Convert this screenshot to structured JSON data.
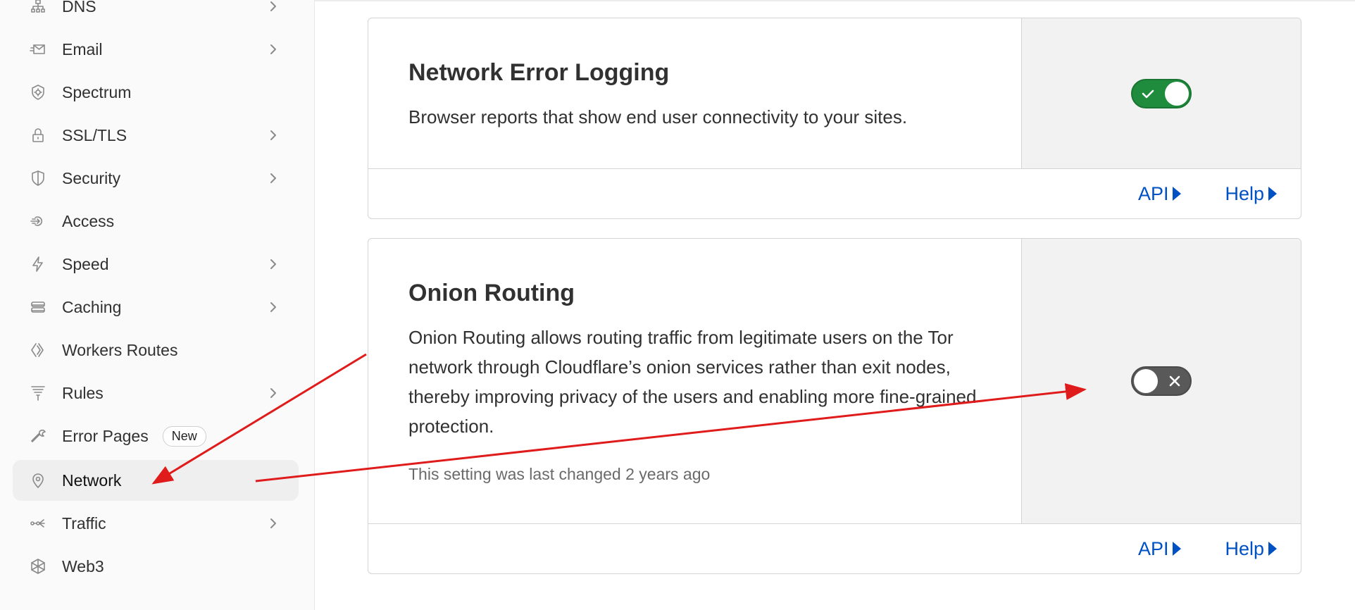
{
  "sidebar": {
    "items": [
      {
        "label": "DNS",
        "icon": "dns-icon",
        "chevron": true
      },
      {
        "label": "Email",
        "icon": "email-icon",
        "chevron": true
      },
      {
        "label": "Spectrum",
        "icon": "spectrum-icon",
        "chevron": false
      },
      {
        "label": "SSL/TLS",
        "icon": "lock-icon",
        "chevron": true
      },
      {
        "label": "Security",
        "icon": "shield-icon",
        "chevron": true
      },
      {
        "label": "Access",
        "icon": "access-icon",
        "chevron": false
      },
      {
        "label": "Speed",
        "icon": "lightning-icon",
        "chevron": true
      },
      {
        "label": "Caching",
        "icon": "server-icon",
        "chevron": true
      },
      {
        "label": "Workers Routes",
        "icon": "workers-icon",
        "chevron": false
      },
      {
        "label": "Rules",
        "icon": "funnel-icon",
        "chevron": true
      },
      {
        "label": "Error Pages",
        "icon": "wrench-icon",
        "chevron": false,
        "badge": "New"
      },
      {
        "label": "Network",
        "icon": "location-pin-icon",
        "chevron": false,
        "active": true
      },
      {
        "label": "Traffic",
        "icon": "traffic-icon",
        "chevron": true
      },
      {
        "label": "Web3",
        "icon": "web3-icon",
        "chevron": false
      }
    ]
  },
  "cards": {
    "nel": {
      "title": "Network Error Logging",
      "description": "Browser reports that show end user connectivity to your sites.",
      "toggle_state": "on",
      "api_label": "API",
      "help_label": "Help"
    },
    "onion": {
      "title": "Onion Routing",
      "description": "Onion Routing allows routing traffic from legitimate users on the Tor network through Cloudflare’s onion services rather than exit nodes, thereby improving privacy of the users and enabling more fine-grained protection.",
      "meta": "This setting was last changed 2 years ago",
      "toggle_state": "off",
      "api_label": "API",
      "help_label": "Help"
    }
  },
  "colors": {
    "link": "#0051c3",
    "toggle_on": "#1f8b3c",
    "toggle_off": "#595959",
    "annotation": "#e01b1b"
  }
}
